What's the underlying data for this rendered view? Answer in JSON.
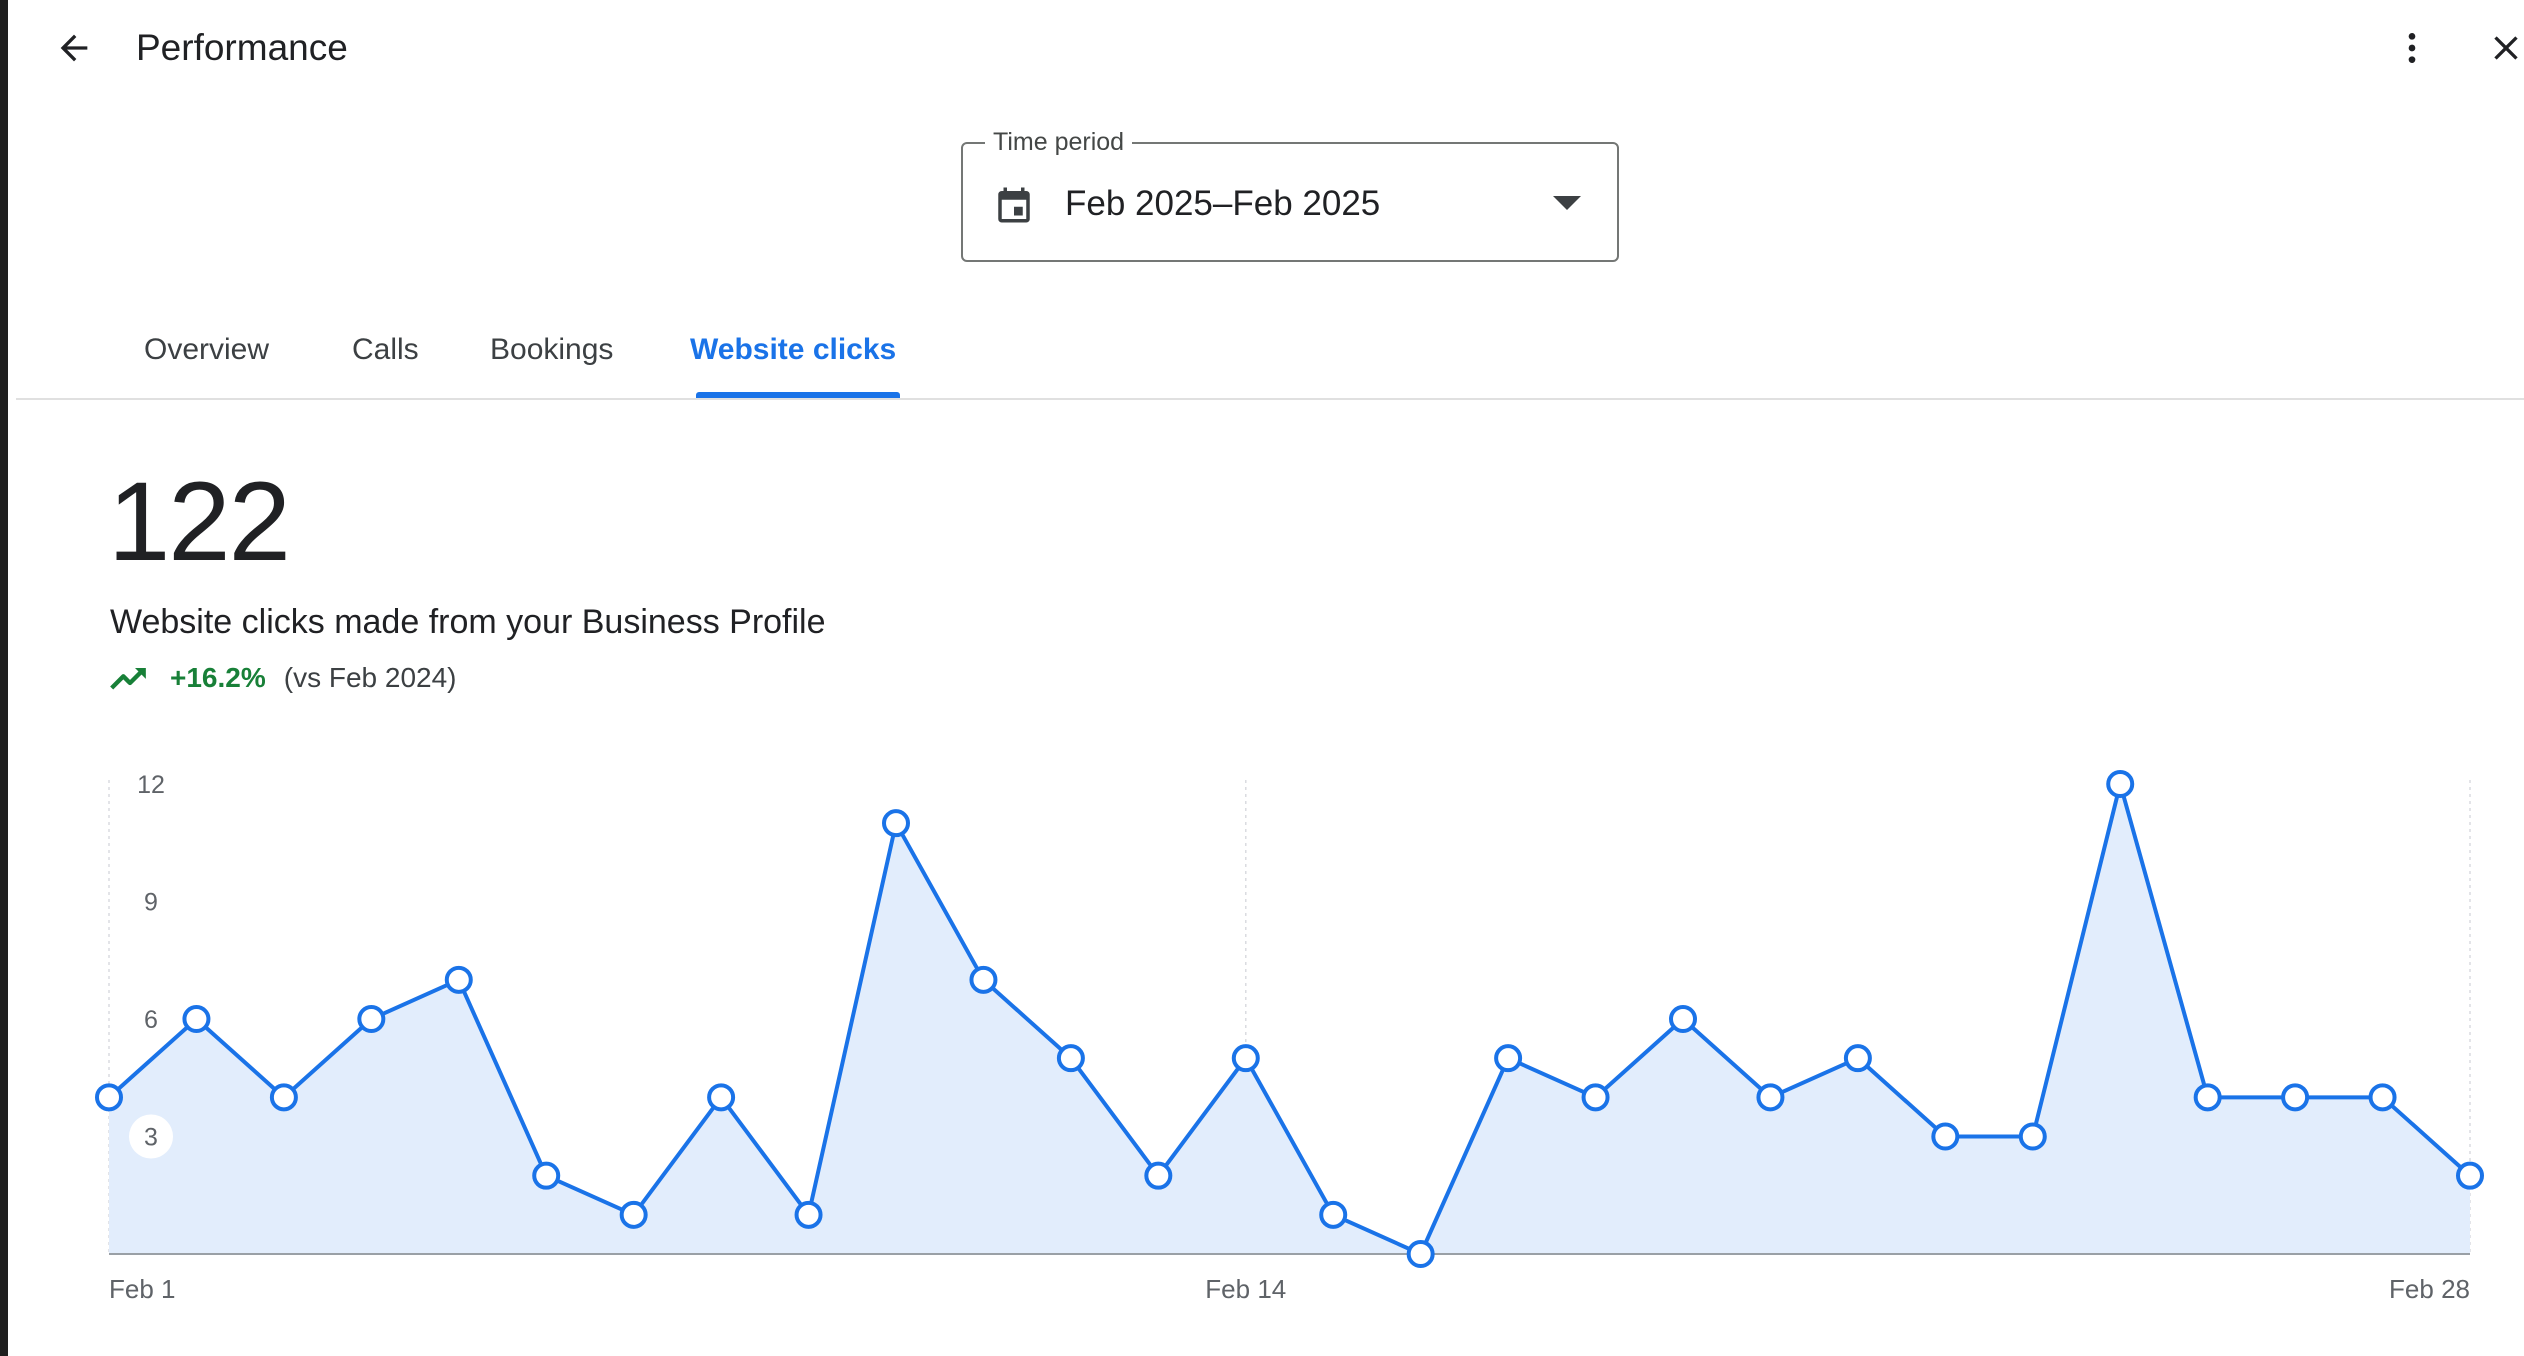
{
  "header": {
    "title": "Performance",
    "back_icon": "arrow-back-icon",
    "more_icon": "more-vert-icon",
    "close_icon": "close-icon"
  },
  "time_period": {
    "label": "Time period",
    "value": "Feb 2025–Feb 2025",
    "icon": "calendar-icon"
  },
  "tabs": [
    {
      "label": "Overview",
      "active": false
    },
    {
      "label": "Calls",
      "active": false
    },
    {
      "label": "Bookings",
      "active": false
    },
    {
      "label": "Website clicks",
      "active": true
    }
  ],
  "summary": {
    "total": "122",
    "description": "Website clicks made from your Business Profile",
    "change": "+16.2%",
    "comparison": "(vs Feb 2024)",
    "change_color": "#188038"
  },
  "colors": {
    "accent": "#1a73e8",
    "area_fill": "#e2edfc"
  },
  "chart_data": {
    "type": "area",
    "x": [
      1,
      2,
      3,
      4,
      5,
      6,
      7,
      8,
      9,
      10,
      11,
      12,
      13,
      14,
      15,
      16,
      17,
      18,
      19,
      20,
      21,
      22,
      23,
      24,
      25,
      26,
      27,
      28
    ],
    "values": [
      4,
      6,
      4,
      6,
      7,
      2,
      1,
      4,
      1,
      11,
      7,
      5,
      2,
      5,
      1,
      0,
      5,
      4,
      6,
      4,
      5,
      3,
      3,
      12,
      4,
      4,
      4,
      2
    ],
    "x_tick_labels": [
      "Feb 1",
      "Feb 14",
      "Feb 28"
    ],
    "x_tick_positions": [
      1,
      14,
      28
    ],
    "y_tick_labels": [
      "3",
      "6",
      "9",
      "12"
    ],
    "y_ticks": [
      3,
      6,
      9,
      12
    ],
    "ylim": [
      0,
      12
    ],
    "title": "",
    "xlabel": "",
    "ylabel": "",
    "grid": "vertical-dashed"
  }
}
